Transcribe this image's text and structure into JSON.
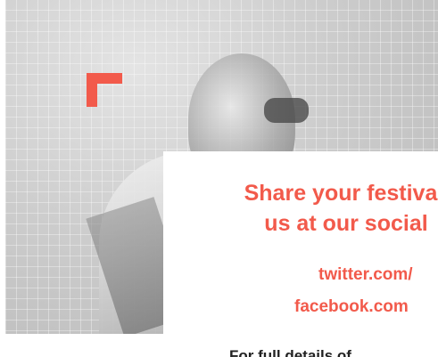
{
  "colors": {
    "accent": "#f25a4b",
    "card_background": "#ffffff",
    "body_text": "#222222"
  },
  "hero": {
    "image_description_icon": "photo-background",
    "bracket_icon": "corner-bracket-icon"
  },
  "card": {
    "headline_line1": "Share your festiva",
    "headline_line2": "us at our social",
    "links": [
      {
        "label": "twitter.com/"
      },
      {
        "label": "facebook.com"
      }
    ],
    "details_text": "For full details of"
  }
}
